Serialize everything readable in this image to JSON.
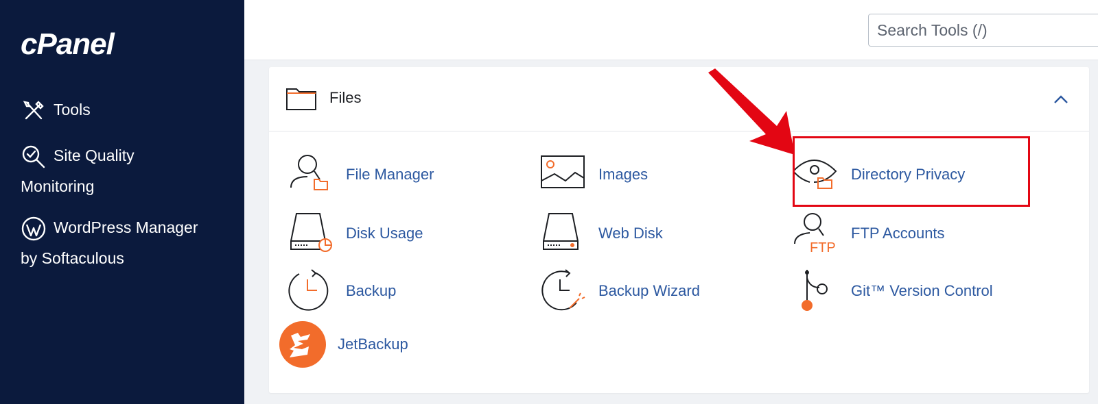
{
  "sidebar": {
    "logo": "cPanel",
    "items": [
      {
        "label": "Tools",
        "icon": "tools-icon"
      },
      {
        "label_line1": "Site Quality",
        "label_line2": "Monitoring",
        "icon": "site-quality-icon"
      },
      {
        "label_line1": "WordPress Manager",
        "label_line2": "by Softaculous",
        "icon": "wordpress-icon"
      }
    ]
  },
  "header": {
    "search_placeholder": "Search Tools (/)"
  },
  "files_panel": {
    "title": "Files",
    "tools": [
      {
        "label": "File Manager",
        "icon": "file-manager-icon"
      },
      {
        "label": "Images",
        "icon": "images-icon"
      },
      {
        "label": "Directory Privacy",
        "icon": "directory-privacy-icon"
      },
      {
        "label": "Disk Usage",
        "icon": "disk-usage-icon"
      },
      {
        "label": "Web Disk",
        "icon": "web-disk-icon"
      },
      {
        "label": "FTP Accounts",
        "icon": "ftp-accounts-icon"
      },
      {
        "label": "Backup",
        "icon": "backup-icon"
      },
      {
        "label": "Backup Wizard",
        "icon": "backup-wizard-icon"
      },
      {
        "label": "Git™ Version Control",
        "icon": "git-icon"
      },
      {
        "label": "JetBackup",
        "icon": "jetbackup-icon"
      }
    ]
  },
  "colors": {
    "sidebar_bg": "#0b1a3d",
    "link": "#2c58a0",
    "accent_orange": "#f26c2b",
    "annotation_red": "#e30613"
  }
}
